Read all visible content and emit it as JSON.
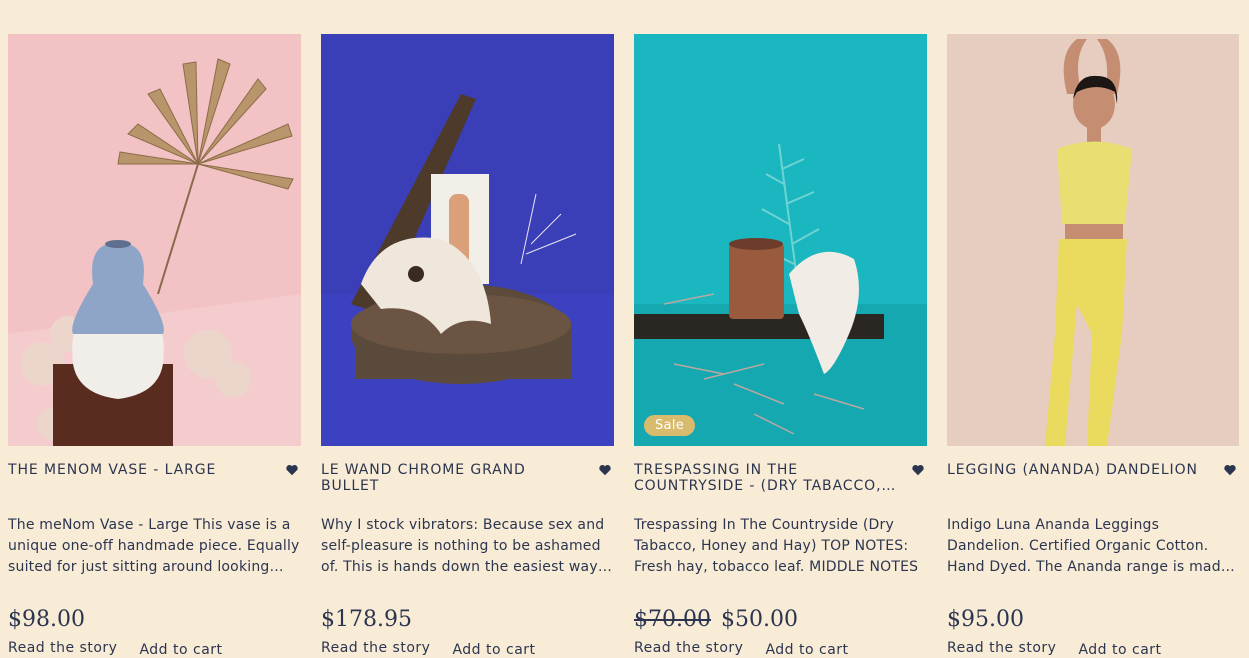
{
  "products": [
    {
      "title": "THE MENOM VASE - LARGE",
      "description": "The meNom Vase - Large This vase is a unique one-off handmade piece. Equally suited for just sitting around looking beautiful.",
      "price": "$98.00",
      "old_price": "",
      "sale": "",
      "read_label": "Read the story",
      "cart_label": "Add to cart"
    },
    {
      "title": "LE WAND CHROME GRAND BULLET",
      "description": "Why I stock vibrators: Because sex and self-pleasure is nothing to be ashamed of. This is hands down the easiest way to",
      "price": "$178.95",
      "old_price": "",
      "sale": "",
      "read_label": "Read the story",
      "cart_label": "Add to cart"
    },
    {
      "title": "TRESPASSING IN THE COUNTRYSIDE - (DRY TABACCO, HONEY AND HAY)",
      "description": "Trespassing In The Countryside (Dry Tabacco, Honey and Hay) TOP NOTES: Fresh hay, tobacco leaf. MIDDLE NOTES",
      "price": "$50.00",
      "old_price": "$70.00",
      "sale": "Sale",
      "read_label": "Read the story",
      "cart_label": "Add to cart"
    },
    {
      "title": "LEGGING (ANANDA) DANDELION",
      "description": "Indigo Luna Ananda Leggings Dandelion. Certified Organic Cotton. Hand Dyed. The Ananda range is made from",
      "price": "$95.00",
      "old_price": "",
      "sale": "",
      "read_label": "Read the story",
      "cart_label": "Add to cart"
    }
  ],
  "colors": {
    "background": "#f8ecd6",
    "text": "#2c3550",
    "sale_badge": "#d9bb6e"
  },
  "icons": {
    "wishlist": "heart-icon"
  }
}
